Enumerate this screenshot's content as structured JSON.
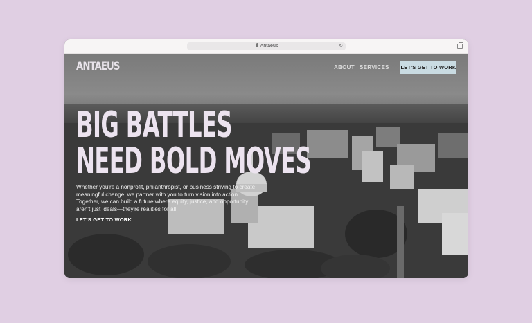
{
  "browser": {
    "url_text": "Antaeus"
  },
  "nav": {
    "logo": "ANTAEUS",
    "links": [
      "ABOUT",
      "SERVICES"
    ],
    "cta": "LET'S GET TO WORK"
  },
  "hero": {
    "headline_line1": "BIG BATTLES",
    "headline_line2": "NEED BOLD MOVES",
    "body": "Whether you're a nonprofit, philanthropist, or business striving to create meaningful change, we partner with you to turn vision into action. Together, we can build a future where equity, justice, and opportunity aren't just ideals—they're realities for all.",
    "cta": "LET'S GET TO WORK"
  }
}
